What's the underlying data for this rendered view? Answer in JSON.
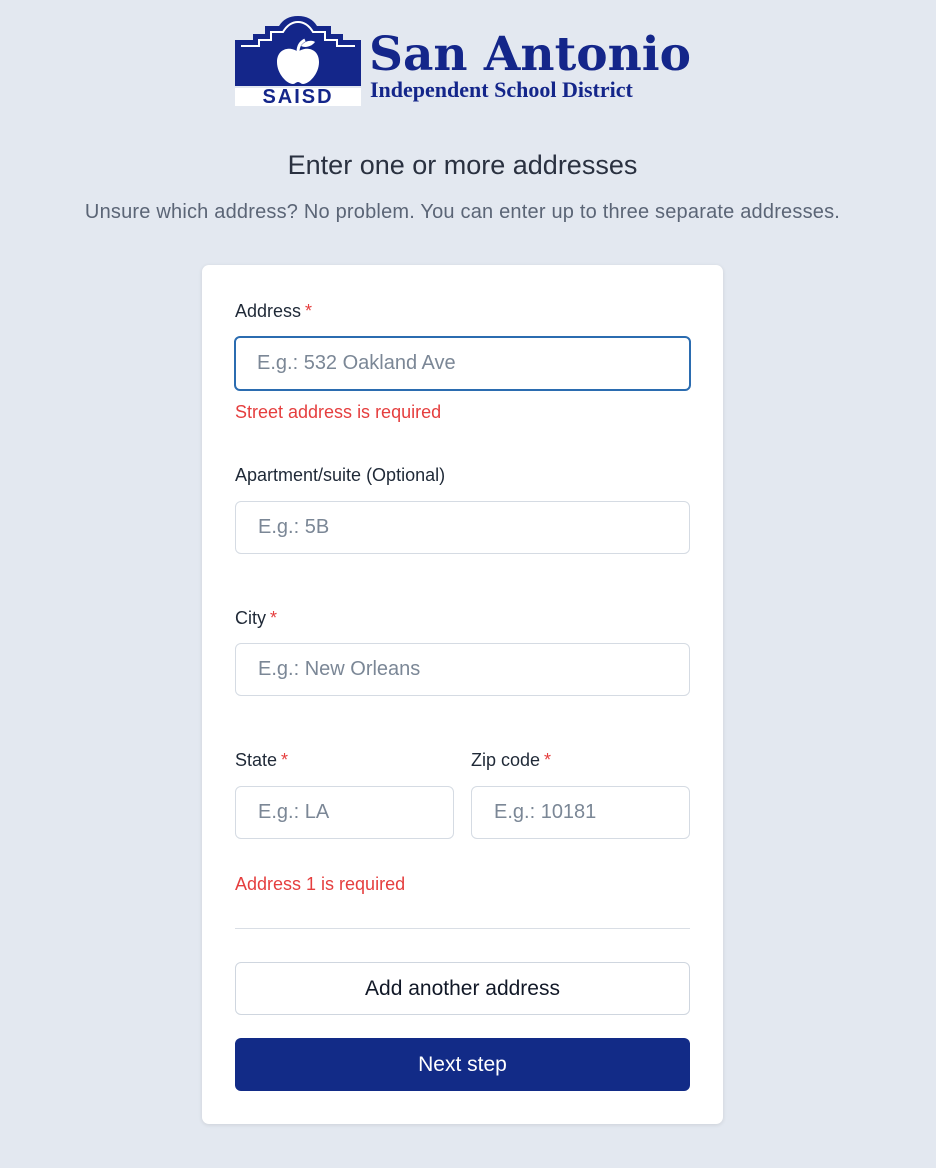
{
  "logo": {
    "name": "San Antonio",
    "subtitle": "Independent School District",
    "abbr": "SAISD",
    "brand_color": "#14268a"
  },
  "heading": "Enter one or more addresses",
  "subheading": "Unsure which address? No problem. You can enter up to three separate addresses.",
  "form": {
    "address": {
      "label": "Address",
      "required_mark": "*",
      "placeholder": "E.g.: 532 Oakland Ave",
      "value": "",
      "error": "Street address is required"
    },
    "apartment": {
      "label": "Apartment/suite (Optional)",
      "placeholder": "E.g.: 5B",
      "value": ""
    },
    "city": {
      "label": "City",
      "required_mark": "*",
      "placeholder": "E.g.: New Orleans",
      "value": ""
    },
    "state": {
      "label": "State",
      "required_mark": "*",
      "placeholder": "E.g.: LA",
      "value": ""
    },
    "zip": {
      "label": "Zip code",
      "required_mark": "*",
      "placeholder": "E.g.: 10181",
      "value": ""
    },
    "address_error": "Address 1 is required",
    "add_button_label": "Add another address",
    "next_button_label": "Next step"
  },
  "colors": {
    "background": "#e3e8f0",
    "primary": "#122b87",
    "error": "#e53e3e",
    "focus": "#2b6cb0"
  }
}
